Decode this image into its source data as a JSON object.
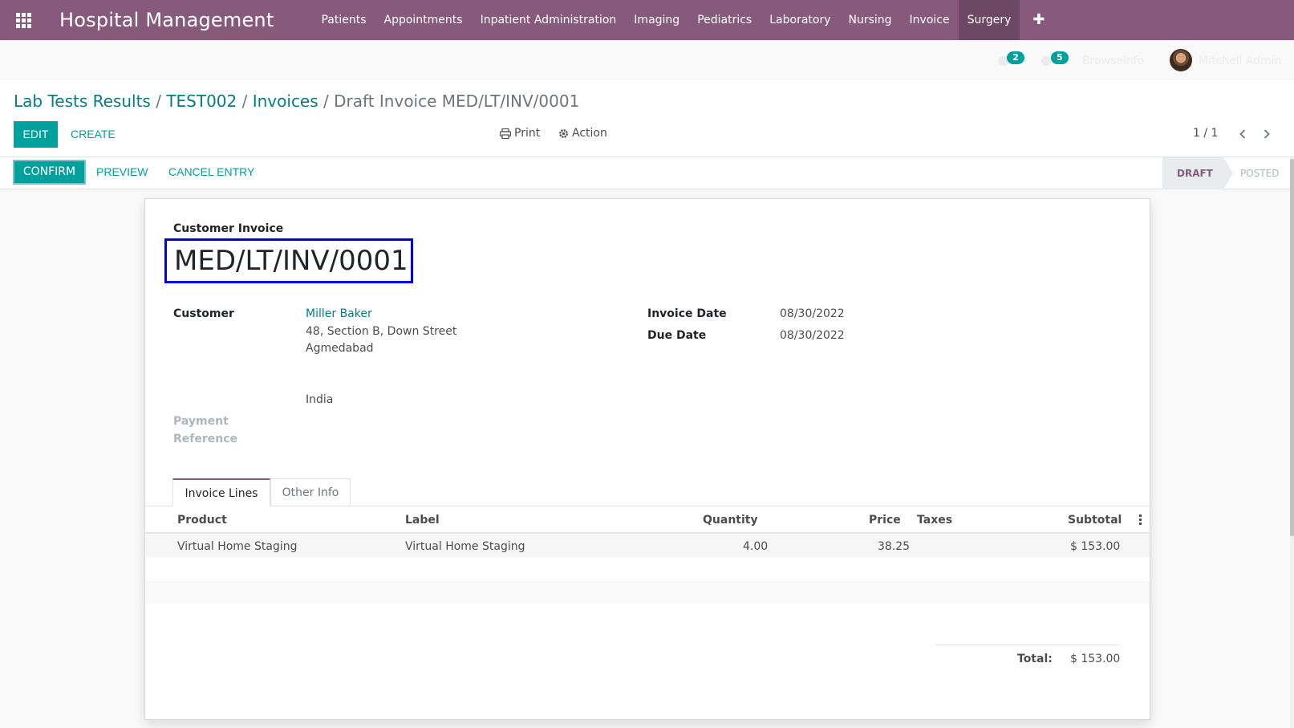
{
  "navbar": {
    "app_title": "Hospital Management",
    "menu": [
      "Patients",
      "Appointments",
      "Inpatient Administration",
      "Imaging",
      "Pediatrics",
      "Laboratory",
      "Nursing",
      "Invoice",
      "Surgery"
    ],
    "active_menu": "Surgery",
    "plus": "✚"
  },
  "systray": {
    "messages_count": "2",
    "activity_count": "5",
    "company": "Browseinfo",
    "user": "Mitchell Admin"
  },
  "breadcrumb": {
    "items": [
      "Lab Tests Results",
      "TEST002",
      "Invoices"
    ],
    "separator": "/",
    "current": "Draft Invoice MED/LT/INV/0001"
  },
  "control": {
    "edit_label": "EDIT",
    "create_label": "CREATE",
    "print_label": "Print",
    "action_label": "Action",
    "pager": "1 / 1"
  },
  "statusbar": {
    "confirm_label": "CONFIRM",
    "preview_label": "PREVIEW",
    "cancel_label": "CANCEL ENTRY",
    "stages": [
      "DRAFT",
      "POSTED"
    ],
    "current_stage": "DRAFT"
  },
  "invoice": {
    "type_label": "Customer Invoice",
    "name": "MED/LT/INV/0001",
    "customer_label": "Customer",
    "customer_name": "Miller Baker",
    "address_line1": "48, Section B, Down Street",
    "address_line2": "Agmedabad",
    "country": "India",
    "payment_ref_label_1": "Payment",
    "payment_ref_label_2": "Reference",
    "invoice_date_label": "Invoice Date",
    "invoice_date": "08/30/2022",
    "due_date_label": "Due Date",
    "due_date": "08/30/2022"
  },
  "tabs": [
    "Invoice Lines",
    "Other Info"
  ],
  "lines": {
    "headers": [
      "Product",
      "Label",
      "Quantity",
      "Price",
      "Taxes",
      "Subtotal"
    ],
    "rows": [
      {
        "product": "Virtual Home Staging",
        "label": "Virtual Home Staging",
        "quantity": "4.00",
        "price": "38.25",
        "taxes": "",
        "subtotal": "$ 153.00"
      }
    ]
  },
  "totals": {
    "total_label": "Total:",
    "total_value": "$ 153.00"
  },
  "colors": {
    "brand": "#875a7b",
    "accent": "#00a09d",
    "link": "#017e84",
    "highlight_border": "#0000ee"
  }
}
